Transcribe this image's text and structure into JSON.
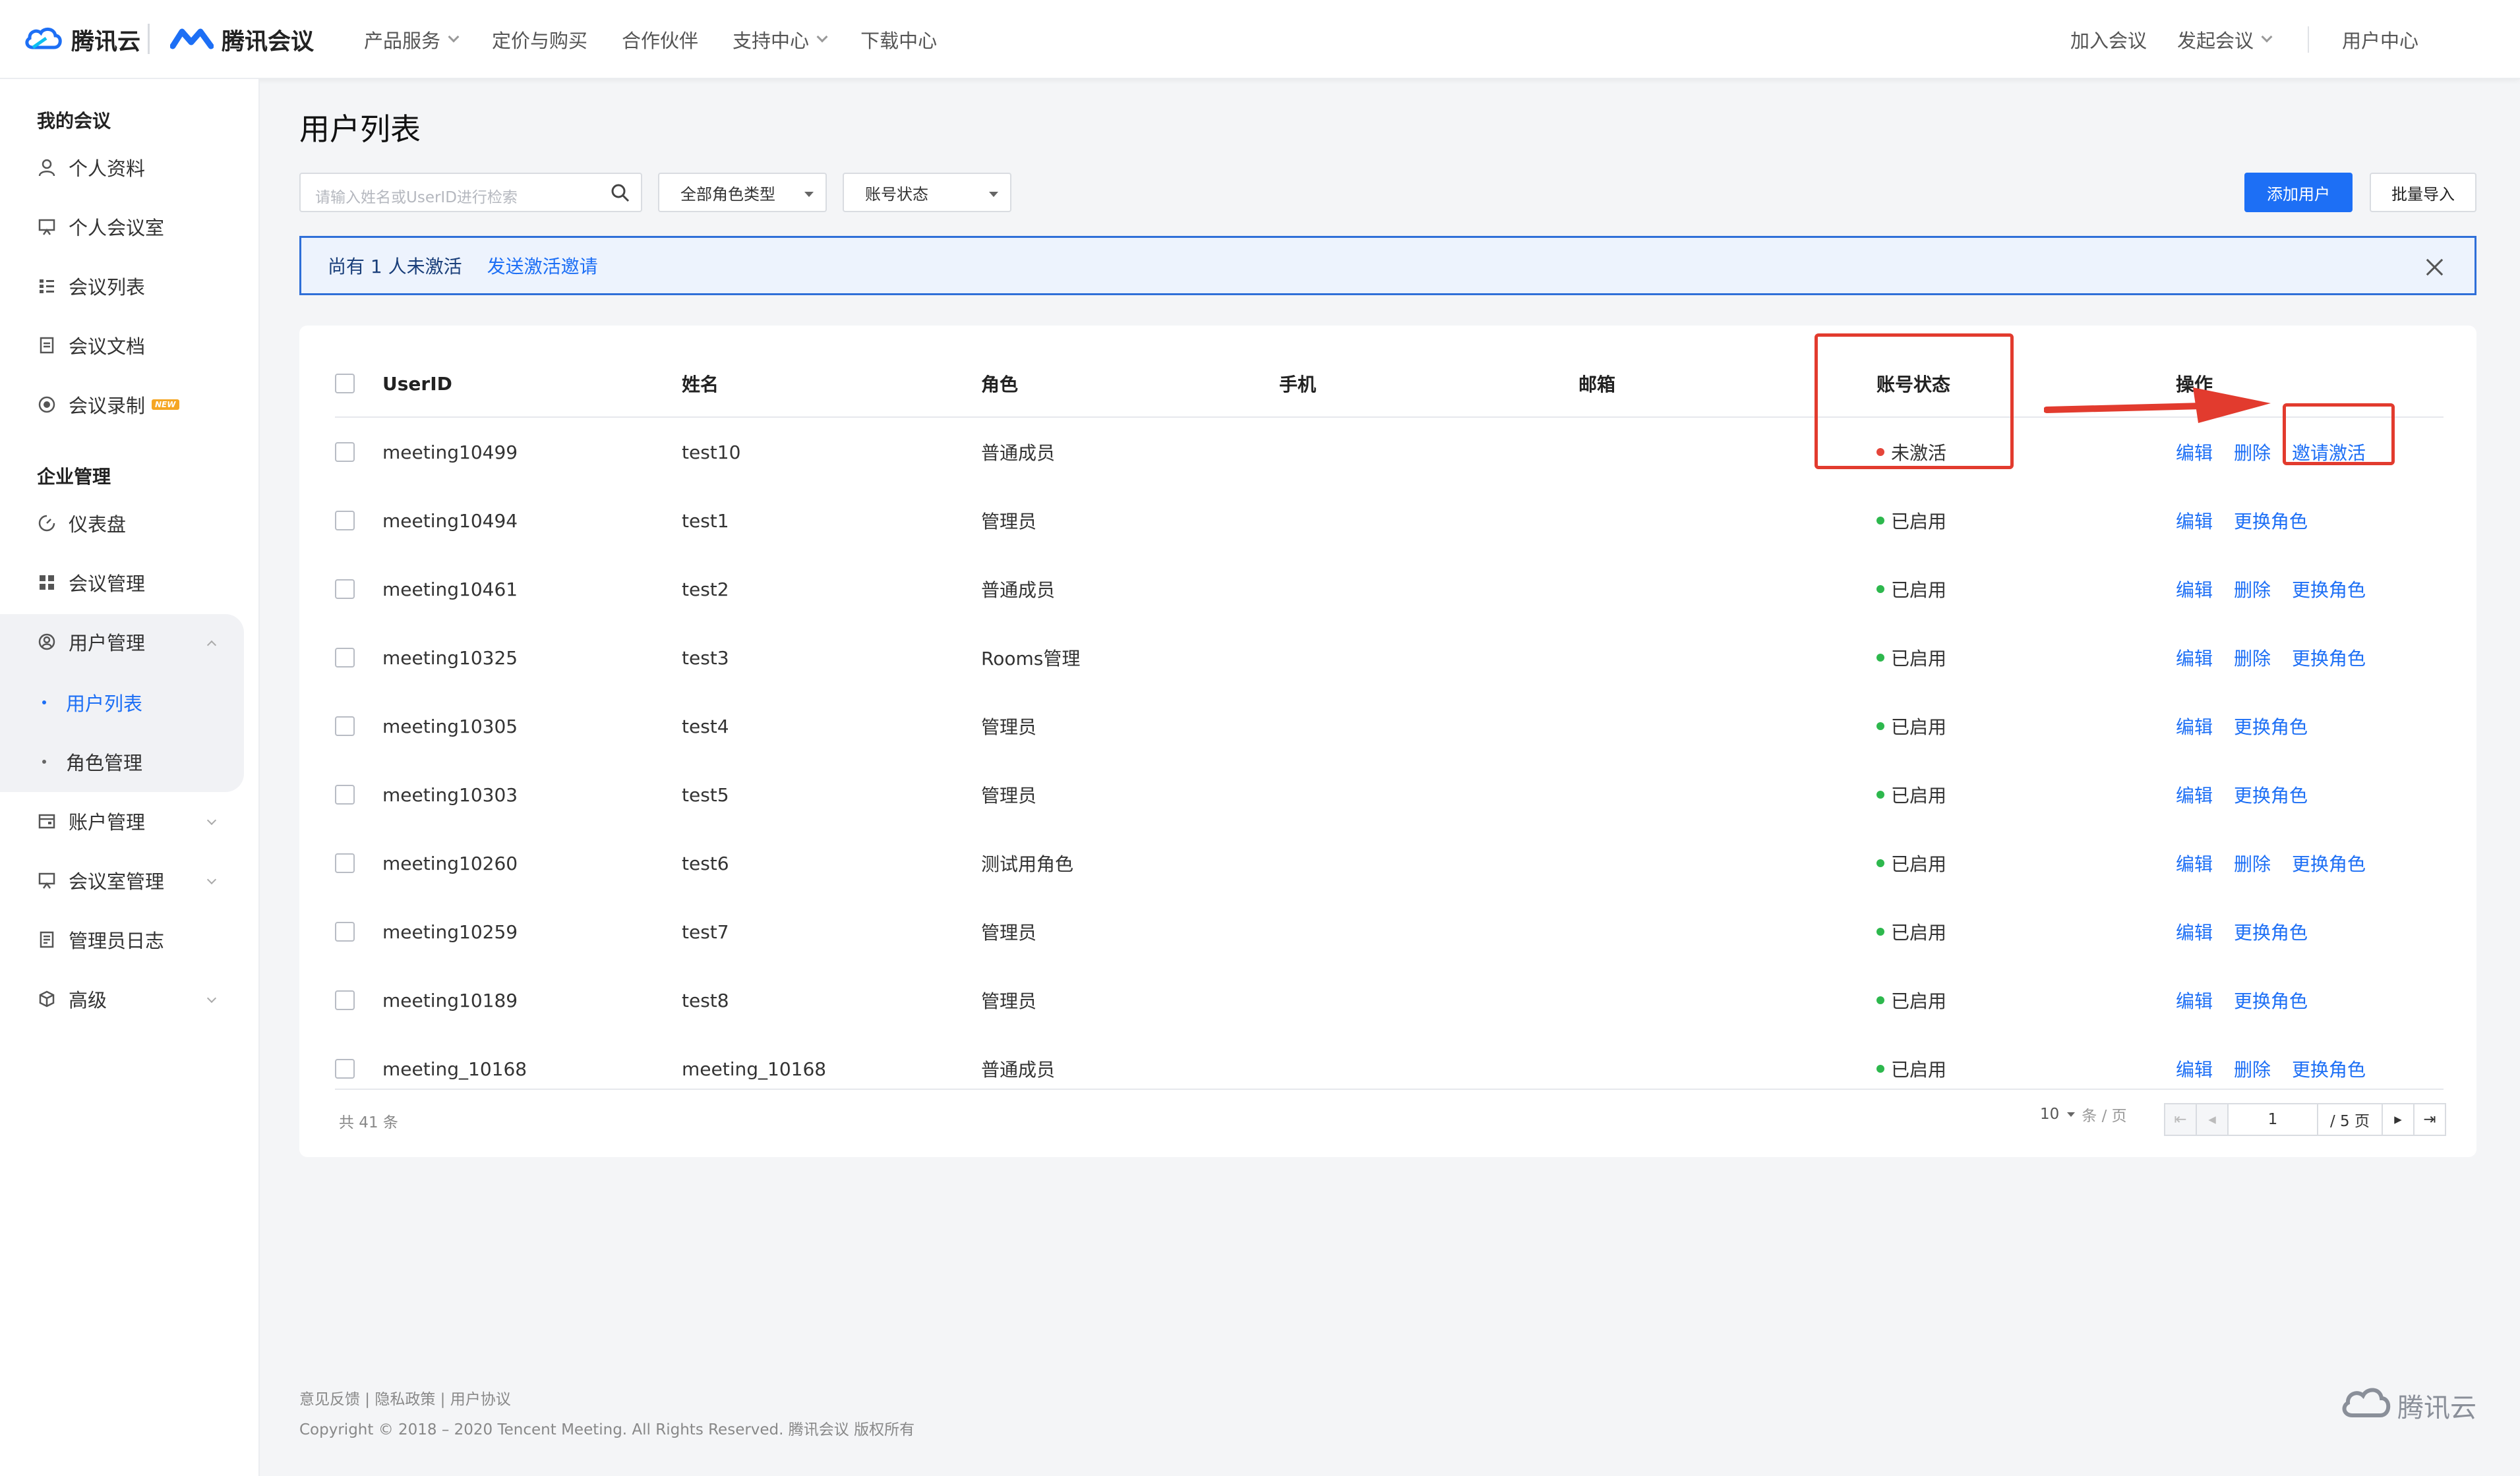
{
  "topnav": {
    "brand_cloud": "腾讯云",
    "brand_meeting": "腾讯会议",
    "items": [
      "产品服务",
      "定价与购买",
      "合作伙伴",
      "支持中心",
      "下载中心"
    ],
    "join": "加入会议",
    "start": "发起会议",
    "user_center": "用户中心"
  },
  "sidebar": {
    "my_meeting_title": "我的会议",
    "my_items": [
      "个人资料",
      "个人会议室",
      "会议列表",
      "会议文档",
      "会议录制"
    ],
    "new_badge": "NEW",
    "enterprise_title": "企业管理",
    "ent_items": [
      "仪表盘",
      "会议管理",
      "用户管理"
    ],
    "user_sub": [
      "用户列表",
      "角色管理"
    ],
    "more_items": [
      "账户管理",
      "会议室管理",
      "管理员日志",
      "高级"
    ]
  },
  "main": {
    "title": "用户列表",
    "search_placeholder": "请输入姓名或UserID进行检索",
    "role_filter": "全部角色类型",
    "status_filter": "账号状态",
    "add_user": "添加用户",
    "batch_import": "批量导入",
    "notice_text": "尚有 1 人未激活",
    "notice_link": "发送激活邀请"
  },
  "table": {
    "headers": [
      "UserID",
      "姓名",
      "角色",
      "手机",
      "邮箱",
      "账号状态",
      "操作"
    ],
    "rows": [
      {
        "userid": "meeting10499",
        "name": "test10",
        "role": "普通成员",
        "status": "未激活",
        "ops": [
          "编辑",
          "删除",
          "邀请激活"
        ]
      },
      {
        "userid": "meeting10494",
        "name": "test1",
        "role": "管理员",
        "status": "已启用",
        "ops": [
          "编辑",
          "更换角色"
        ]
      },
      {
        "userid": "meeting10461",
        "name": "test2",
        "role": "普通成员",
        "status": "已启用",
        "ops": [
          "编辑",
          "删除",
          "更换角色"
        ]
      },
      {
        "userid": "meeting10325",
        "name": "test3",
        "role": "Rooms管理",
        "status": "已启用",
        "ops": [
          "编辑",
          "删除",
          "更换角色"
        ]
      },
      {
        "userid": "meeting10305",
        "name": "test4",
        "role": "管理员",
        "status": "已启用",
        "ops": [
          "编辑",
          "更换角色"
        ]
      },
      {
        "userid": "meeting10303",
        "name": "test5",
        "role": "管理员",
        "status": "已启用",
        "ops": [
          "编辑",
          "更换角色"
        ]
      },
      {
        "userid": "meeting10260",
        "name": "test6",
        "role": "测试用角色",
        "status": "已启用",
        "ops": [
          "编辑",
          "删除",
          "更换角色"
        ]
      },
      {
        "userid": "meeting10259",
        "name": "test7",
        "role": "管理员",
        "status": "已启用",
        "ops": [
          "编辑",
          "更换角色"
        ]
      },
      {
        "userid": "meeting10189",
        "name": "test8",
        "role": "管理员",
        "status": "已启用",
        "ops": [
          "编辑",
          "更换角色"
        ]
      },
      {
        "userid": "meeting_10168",
        "name": "meeting_10168",
        "role": "普通成员",
        "status": "已启用",
        "ops": [
          "编辑",
          "删除",
          "更换角色"
        ]
      }
    ],
    "total": "共 41 条",
    "page_size": "10",
    "page_size_unit": "条 / 页",
    "current_page": "1",
    "total_pages": "/ 5 页"
  },
  "colors": {
    "accent": "#1d6ff5",
    "status_active": "#2db84d",
    "status_inactive": "#e5453a",
    "annotation_red": "#e23b2e"
  },
  "footer": {
    "links": "意见反馈 | 隐私政策 | 用户协议",
    "copyright": "Copyright © 2018 – 2020 Tencent Meeting. All Rights Reserved. 腾讯会议 版权所有",
    "logo_text": "腾讯云"
  }
}
